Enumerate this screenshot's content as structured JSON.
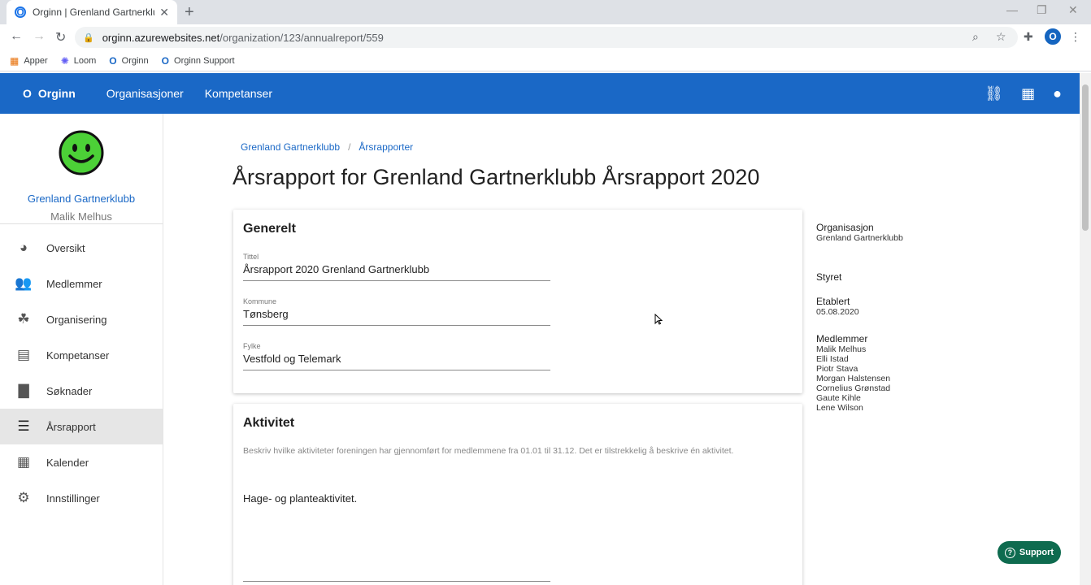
{
  "browser": {
    "tab_title": "Orginn | Grenland Gartnerklubb",
    "url_host": "orginn.azurewebsites.net",
    "url_path": "/organization/123/annualreport/559",
    "profile_letter": "O",
    "bookmarks": [
      {
        "label": "Apper",
        "icon": "apps-grid-icon"
      },
      {
        "label": "Loom",
        "icon": "loom-icon"
      },
      {
        "label": "Orginn",
        "icon": "orginn-icon"
      },
      {
        "label": "Orginn Support",
        "icon": "orginn-icon"
      }
    ]
  },
  "appbar": {
    "brand_letter": "O",
    "brand": "Orginn",
    "nav": [
      "Organisasjoner",
      "Kompetanser"
    ],
    "color": "#1a68c6"
  },
  "sidebar": {
    "org_name": "Grenland Gartnerklubb",
    "user_name": "Malik Melhus",
    "items": [
      {
        "label": "Oversikt",
        "icon": "dashboard-icon"
      },
      {
        "label": "Medlemmer",
        "icon": "users-icon"
      },
      {
        "label": "Organisering",
        "icon": "organization-icon"
      },
      {
        "label": "Kompetanser",
        "icon": "id-card-icon"
      },
      {
        "label": "Søknader",
        "icon": "document-icon"
      },
      {
        "label": "Årsrapport",
        "icon": "list-icon",
        "active": true
      },
      {
        "label": "Kalender",
        "icon": "calendar-icon"
      },
      {
        "label": "Innstillinger",
        "icon": "gear-icon"
      }
    ]
  },
  "breadcrumb": [
    "Grenland Gartnerklubb",
    "Årsrapporter"
  ],
  "page_title": "Årsrapport for Grenland Gartnerklubb Årsrapport 2020",
  "generelt": {
    "heading": "Generelt",
    "fields": [
      {
        "label": "Tittel",
        "value": "Årsrapport 2020 Grenland Gartnerklubb"
      },
      {
        "label": "Kommune",
        "value": "Tønsberg"
      },
      {
        "label": "Fylke",
        "value": "Vestfold og Telemark"
      }
    ]
  },
  "aktivitet": {
    "heading": "Aktivitet",
    "description": "Beskriv hvilke aktiviteter foreningen har gjennomført for medlemmene fra 01.01 til 31.12. Det er tilstrekkelig å beskrive én aktivitet.",
    "text": "Hage- og planteaktivitet."
  },
  "info": {
    "organisasjon_label": "Organisasjon",
    "organisasjon_value": "Grenland Gartnerklubb",
    "styret_label": "Styret",
    "etablert_label": "Etablert",
    "etablert_value": "05.08.2020",
    "medlemmer_label": "Medlemmer",
    "medlemmer": [
      "Malik Melhus",
      "Elli Istad",
      "Piotr Stava",
      "Morgan Halstensen",
      "Cornelius Grønstad",
      "Gaute Kihle",
      "Lene Wilson"
    ]
  },
  "support": {
    "label": "Support",
    "color": "#0e6b4f"
  }
}
